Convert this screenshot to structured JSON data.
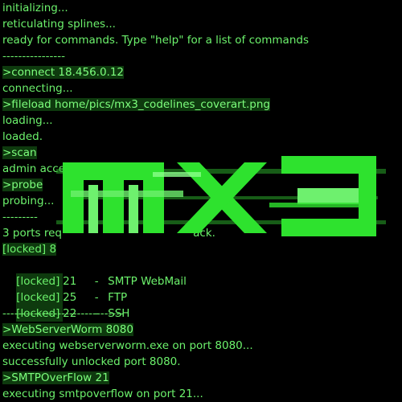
{
  "terminal": {
    "lines": [
      "initializing...",
      "reticulating splines...",
      "ready for commands. Type \"help\" for a list of commands",
      "----------------",
      ">connect 18.456.0.12",
      "connecting...",
      ">fileload home/pics/mx3_codelines_coverart.png",
      "loading...",
      "loaded.",
      ">scan",
      "admin acce",
      ">probe",
      "probing...",
      "---------",
      "3 ports req                                      ack.",
      "[locked] 8"
    ],
    "ports": [
      {
        "status": "[locked]",
        "port": "21",
        "sep": "-",
        "service": "SMTP WebMail"
      },
      {
        "status": "[locked]",
        "port": "25",
        "sep": "-",
        "service": "FTP"
      },
      {
        "status": "[locked]",
        "port": "22",
        "sep": "-",
        "service": "SSH"
      }
    ],
    "after": [
      "-------------------------------",
      ">WebServerWorm 8080",
      "executing webserverworm.exe on port 8080...",
      "successfully unlocked port 8080.",
      ">SMTPOverFlow 21",
      "executing smtpoverflow on port 21..."
    ]
  },
  "logo": {
    "brand": "mx3",
    "colors": {
      "primary": "#2ee22e",
      "light": "#6ef06e",
      "text": "#6cf26c"
    }
  }
}
